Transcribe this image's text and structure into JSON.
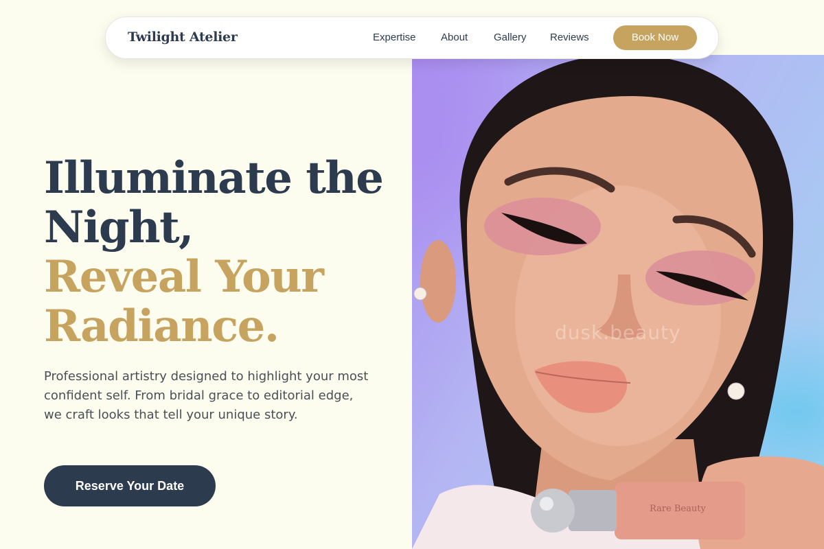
{
  "nav": {
    "brand": "Twilight Atelier",
    "links": [
      "Expertise",
      "About",
      "Gallery",
      "Reviews"
    ],
    "cta_label": "Book Now"
  },
  "hero": {
    "headline_line1": "Illuminate the",
    "headline_line2": "Night,",
    "headline_accent_line1": "Reveal Your",
    "headline_accent_line2": "Radiance.",
    "description": "Professional artistry designed to highlight your most confident self. From bridal grace to editorial edge, we craft looks that tell your unique story.",
    "cta_label": "Reserve Your Date"
  },
  "photo": {
    "watermark": "dusk.beauty",
    "product_label": "Rare Beauty"
  },
  "colors": {
    "background": "#fcfcef",
    "navy": "#2d3b4f",
    "gold": "#c6a35f",
    "white": "#ffffff"
  }
}
